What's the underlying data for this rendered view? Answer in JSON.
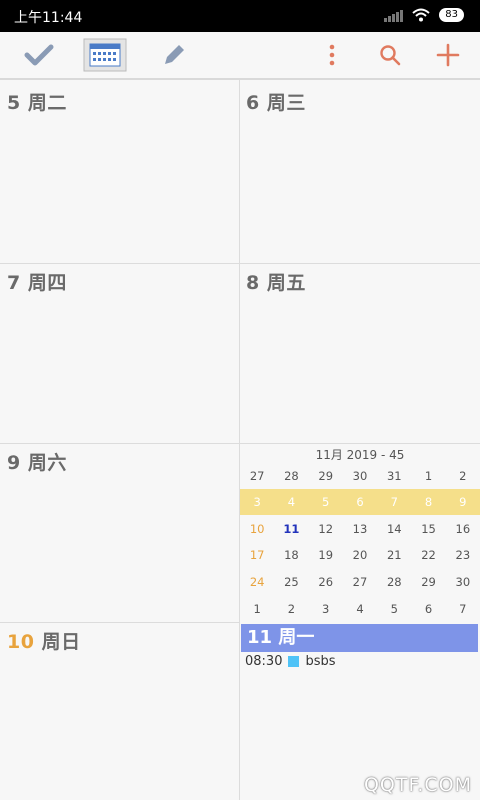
{
  "status_bar": {
    "time": "上午11:44",
    "battery": "83"
  },
  "toolbar": {
    "icons": [
      "check-icon",
      "calendar-icon",
      "pencil-icon",
      "more-vertical-icon",
      "search-icon",
      "add-icon"
    ],
    "accent": "#e07a5f"
  },
  "days": [
    {
      "num": "5",
      "dow": "周二"
    },
    {
      "num": "6",
      "dow": "周三"
    },
    {
      "num": "7",
      "dow": "周四"
    },
    {
      "num": "8",
      "dow": "周五"
    },
    {
      "num": "9",
      "dow": "周六"
    },
    {
      "num": "10",
      "dow": "周日"
    }
  ],
  "today": {
    "num": "11",
    "dow": "周一",
    "color": "#7e94e8"
  },
  "mini_month": {
    "title": "11月 2019 - 45",
    "highlight_color": "#f5df8a",
    "rows": [
      [
        "27",
        "28",
        "29",
        "30",
        "31",
        "1",
        "2"
      ],
      [
        "3",
        "4",
        "5",
        "6",
        "7",
        "8",
        "9"
      ],
      [
        "10",
        "11",
        "12",
        "13",
        "14",
        "15",
        "16"
      ],
      [
        "17",
        "18",
        "19",
        "20",
        "21",
        "22",
        "23"
      ],
      [
        "24",
        "25",
        "26",
        "27",
        "28",
        "29",
        "30"
      ],
      [
        "1",
        "2",
        "3",
        "4",
        "5",
        "6",
        "7"
      ]
    ]
  },
  "events": [
    {
      "time": "08:30",
      "title": "bsbs",
      "color": "#4fc3f7"
    }
  ],
  "watermark": "QQTF.COM"
}
